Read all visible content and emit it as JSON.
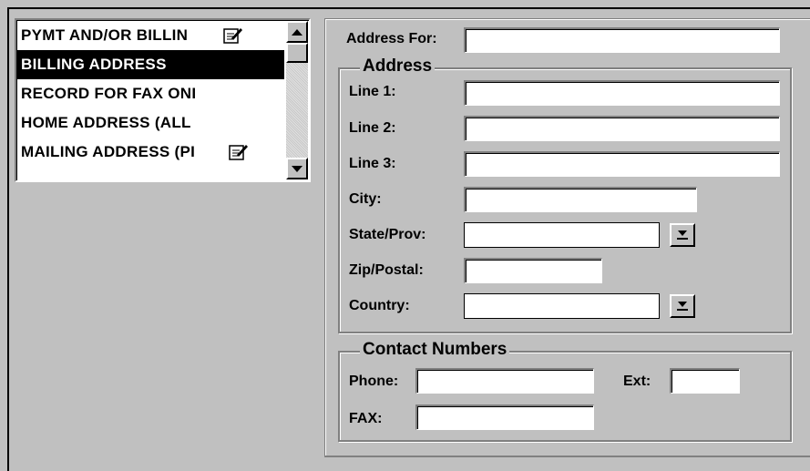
{
  "address_list": {
    "items": [
      {
        "label": "PYMT AND/OR BILLIN",
        "has_note_icon": true,
        "selected": false
      },
      {
        "label": "BILLING ADDRESS",
        "has_note_icon": false,
        "selected": true
      },
      {
        "label": "RECORD FOR FAX ONI",
        "has_note_icon": false,
        "selected": false
      },
      {
        "label": "HOME ADDRESS (ALL",
        "has_note_icon": false,
        "selected": false
      },
      {
        "label": "MAILING ADDRESS (PI",
        "has_note_icon": true,
        "selected": false
      }
    ]
  },
  "form": {
    "address_for_label": "Address For:",
    "address_for_value": "",
    "address_group_title": "Address",
    "line1_label": "Line 1:",
    "line1_value": "",
    "line2_label": "Line 2:",
    "line2_value": "",
    "line3_label": "Line 3:",
    "line3_value": "",
    "city_label": "City:",
    "city_value": "",
    "state_label": "State/Prov:",
    "state_value": "",
    "zip_label": "Zip/Postal:",
    "zip_value": "",
    "country_label": "Country:",
    "country_value": "",
    "contact_group_title": "Contact Numbers",
    "phone_label": "Phone:",
    "phone_value": "",
    "ext_label": "Ext:",
    "ext_value": "",
    "fax_label": "FAX:",
    "fax_value": ""
  },
  "icons": {
    "note": "note-edit-icon",
    "scroll_up": "scroll-up-arrow-icon",
    "scroll_down": "scroll-down-arrow-icon",
    "dropdown": "dropdown-arrow-icon"
  },
  "colors": {
    "background": "#c0c0c0",
    "selection": "#000000",
    "field": "#ffffff"
  }
}
